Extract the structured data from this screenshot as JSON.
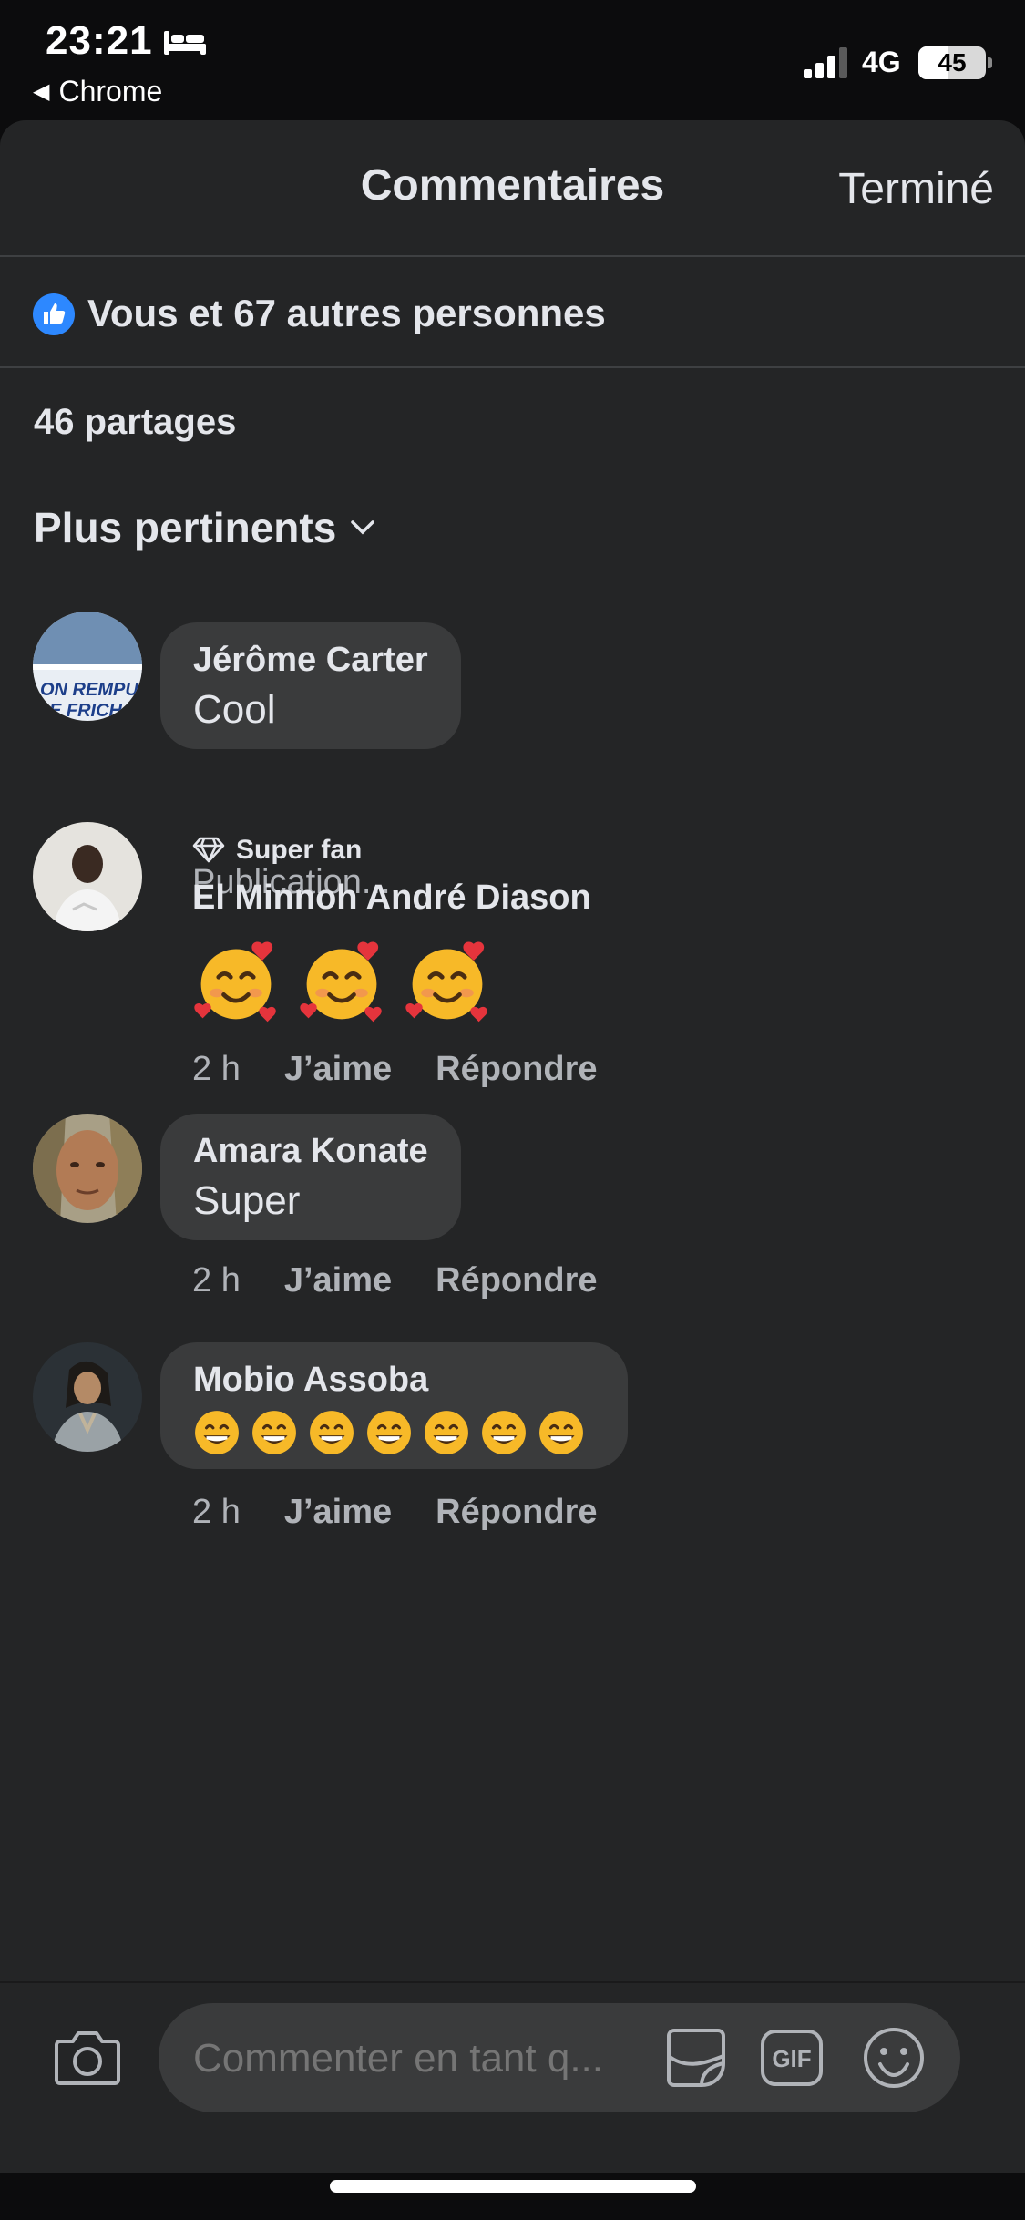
{
  "status_bar": {
    "time": "23:21",
    "back_app": "Chrome",
    "network": "4G",
    "battery": "45",
    "battery_level": 0.45,
    "icons": [
      "bed-icon",
      "signal-icon",
      "battery-icon"
    ]
  },
  "header": {
    "title": "Commentaires",
    "done_label": "Terminé"
  },
  "reactions": {
    "text": "Vous et 67 autres personnes",
    "icon": "like-icon"
  },
  "shares": "46 partages",
  "sort": {
    "label": "Plus pertinents",
    "icon": "chevron-down-icon"
  },
  "comments": [
    {
      "author": "Jérôme Carter",
      "text": "Cool",
      "status": "Publication..."
    },
    {
      "badge": "Super fan",
      "badge_icon": "diamond-icon",
      "author": "El Minnoh André Diason",
      "emoji": "smiling-face-with-hearts",
      "emoji_count": 3,
      "time": "2 h",
      "like_label": "J’aime",
      "reply_label": "Répondre"
    },
    {
      "author": "Amara Konate",
      "text": "Super",
      "time": "2 h",
      "like_label": "J’aime",
      "reply_label": "Répondre"
    },
    {
      "author": "Mobio Assoba",
      "emoji": "grinning-face-with-smiling-eyes",
      "emoji_count": 7,
      "time": "2 h",
      "like_label": "J’aime",
      "reply_label": "Répondre"
    }
  ],
  "composer": {
    "placeholder": "Commenter en tant q...",
    "gif_label": "GIF",
    "icons": [
      "camera-icon",
      "sticker-icon",
      "gif-icon",
      "emoji-icon"
    ]
  },
  "colors": {
    "sheet_bg": "#242526",
    "bubble_bg": "#3a3b3c",
    "like_blue": "#2d88ff",
    "muted_text": "#b0b3b8"
  }
}
